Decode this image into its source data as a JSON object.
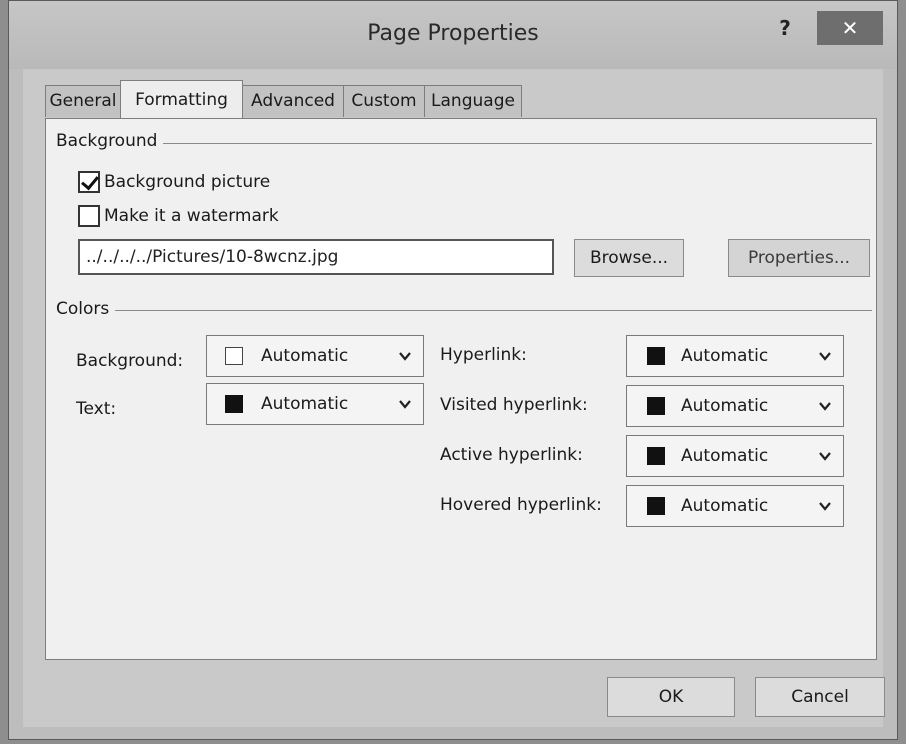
{
  "dialog": {
    "title": "Page Properties",
    "help_label": "?",
    "close_label": "✕"
  },
  "tabs": [
    {
      "label": "General"
    },
    {
      "label": "Formatting"
    },
    {
      "label": "Advanced"
    },
    {
      "label": "Custom"
    },
    {
      "label": "Language"
    }
  ],
  "active_tab": "Formatting",
  "background_group": {
    "label": "Background",
    "background_picture": {
      "label": "Background picture",
      "checked": true
    },
    "watermark": {
      "label": "Make it a watermark",
      "checked": false
    },
    "picture_path": "../../../../Pictures/10-8wcnz.jpg",
    "browse_label": "Browse...",
    "properties_label": "Properties..."
  },
  "colors_group": {
    "label": "Colors",
    "background": {
      "label": "Background:",
      "value": "Automatic",
      "swatch": "#ffffff"
    },
    "text": {
      "label": "Text:",
      "value": "Automatic",
      "swatch": "#111111"
    },
    "hyperlink": {
      "label": "Hyperlink:",
      "value": "Automatic",
      "swatch": "#111111"
    },
    "visited_hyperlink": {
      "label": "Visited hyperlink:",
      "value": "Automatic",
      "swatch": "#111111"
    },
    "active_hyperlink": {
      "label": "Active hyperlink:",
      "value": "Automatic",
      "swatch": "#111111"
    },
    "hovered_hyperlink": {
      "label": "Hovered hyperlink:",
      "value": "Automatic",
      "swatch": "#111111"
    }
  },
  "footer": {
    "ok_label": "OK",
    "cancel_label": "Cancel"
  },
  "icons": {
    "help": "question-mark-icon",
    "close": "close-icon",
    "dropdown": "chevron-down-icon"
  }
}
